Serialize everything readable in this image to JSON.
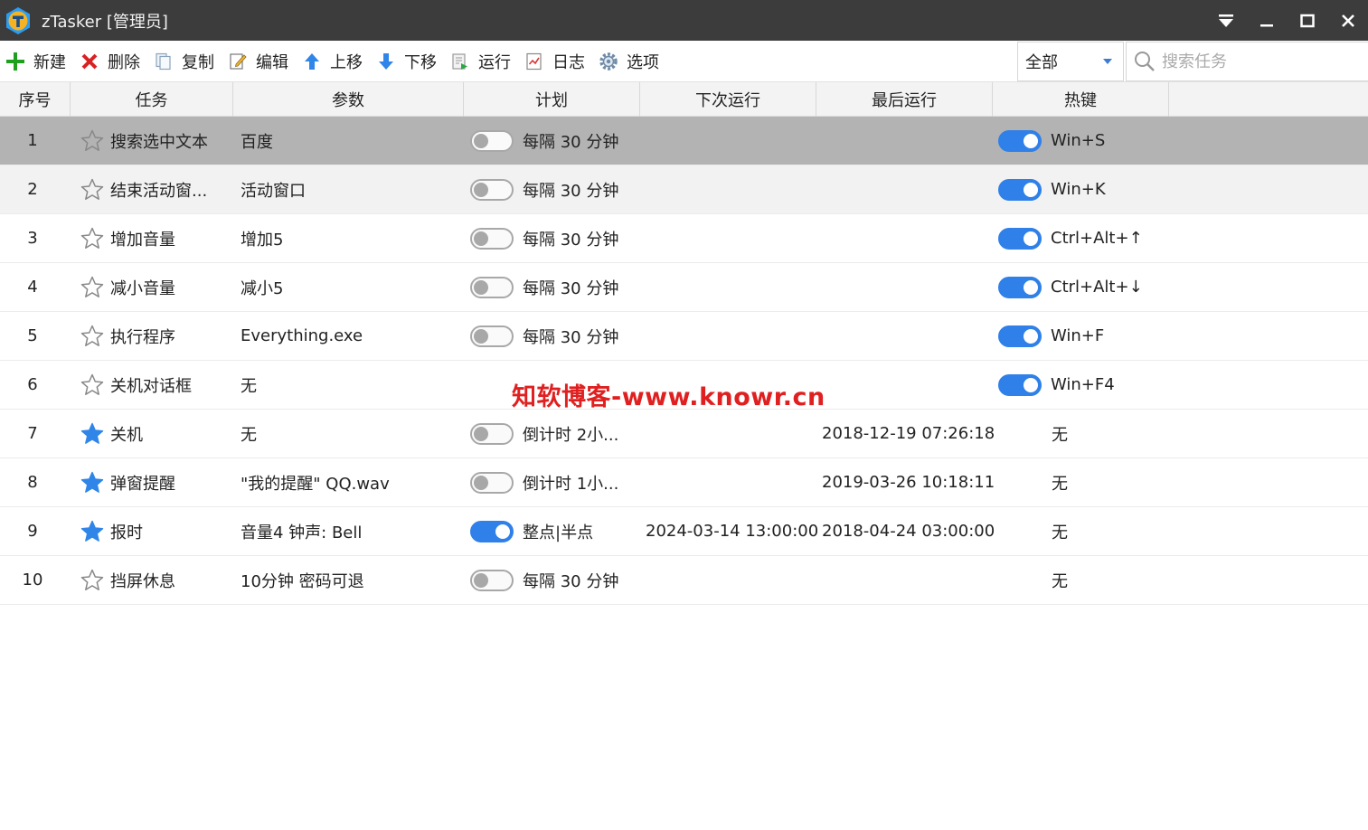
{
  "window": {
    "title": "zTasker [管理员]"
  },
  "toolbar": {
    "new": "新建",
    "delete": "删除",
    "copy": "复制",
    "edit": "编辑",
    "move_up": "上移",
    "move_down": "下移",
    "run": "运行",
    "log": "日志",
    "options": "选项"
  },
  "filter": {
    "selected": "全部"
  },
  "search": {
    "placeholder": "搜索任务"
  },
  "columns": [
    "序号",
    "任务",
    "参数",
    "计划",
    "下次运行",
    "最后运行",
    "热键"
  ],
  "rows": [
    {
      "num": "1",
      "task": "搜索选中文本",
      "starred": false,
      "param": "百度",
      "plan_on": false,
      "plan": "每隔 30 分钟",
      "next": "",
      "last": "",
      "hotkey_on": true,
      "hotkey": "Win+S",
      "state": "selected"
    },
    {
      "num": "2",
      "task": "结束活动窗...",
      "starred": false,
      "param": "活动窗口",
      "plan_on": false,
      "plan": "每隔 30 分钟",
      "next": "",
      "last": "",
      "hotkey_on": true,
      "hotkey": "Win+K",
      "state": "hover"
    },
    {
      "num": "3",
      "task": "增加音量",
      "starred": false,
      "param": "增加5",
      "plan_on": false,
      "plan": "每隔 30 分钟",
      "next": "",
      "last": "",
      "hotkey_on": true,
      "hotkey": "Ctrl+Alt+↑",
      "state": ""
    },
    {
      "num": "4",
      "task": "减小音量",
      "starred": false,
      "param": "减小5",
      "plan_on": false,
      "plan": "每隔 30 分钟",
      "next": "",
      "last": "",
      "hotkey_on": true,
      "hotkey": "Ctrl+Alt+↓",
      "state": ""
    },
    {
      "num": "5",
      "task": "执行程序",
      "starred": false,
      "param": "Everything.exe",
      "plan_on": false,
      "plan": "每隔 30 分钟",
      "next": "",
      "last": "",
      "hotkey_on": true,
      "hotkey": "Win+F",
      "state": ""
    },
    {
      "num": "6",
      "task": "关机对话框",
      "starred": false,
      "param": "无",
      "plan_on": null,
      "plan": "",
      "next": "",
      "last": "",
      "hotkey_on": true,
      "hotkey": "Win+F4",
      "state": ""
    },
    {
      "num": "7",
      "task": "关机",
      "starred": true,
      "param": "无",
      "plan_on": false,
      "plan": "倒计时 2小...",
      "next": "",
      "last": "2018-12-19 07:26:18",
      "hotkey_on": null,
      "hotkey": "无",
      "state": ""
    },
    {
      "num": "8",
      "task": "弹窗提醒",
      "starred": true,
      "param": "\"我的提醒\" QQ.wav",
      "plan_on": false,
      "plan": "倒计时 1小...",
      "next": "",
      "last": "2019-03-26 10:18:11",
      "hotkey_on": null,
      "hotkey": "无",
      "state": ""
    },
    {
      "num": "9",
      "task": "报时",
      "starred": true,
      "param": "音量4 钟声: Bell",
      "plan_on": true,
      "plan": "整点|半点",
      "next": "2024-03-14 13:00:00",
      "last": "2018-04-24 03:00:00",
      "hotkey_on": null,
      "hotkey": "无",
      "state": ""
    },
    {
      "num": "10",
      "task": "挡屏休息",
      "starred": false,
      "param": "10分钟 密码可退",
      "plan_on": false,
      "plan": "每隔 30 分钟",
      "next": "",
      "last": "",
      "hotkey_on": null,
      "hotkey": "无",
      "state": ""
    }
  ],
  "watermark": "知软博客-www.knowr.cn",
  "colors": {
    "titlebar": "#3c3c3c",
    "accent": "#2f80e8",
    "selected_row": "#b3b3b3",
    "watermark": "#e02020"
  }
}
